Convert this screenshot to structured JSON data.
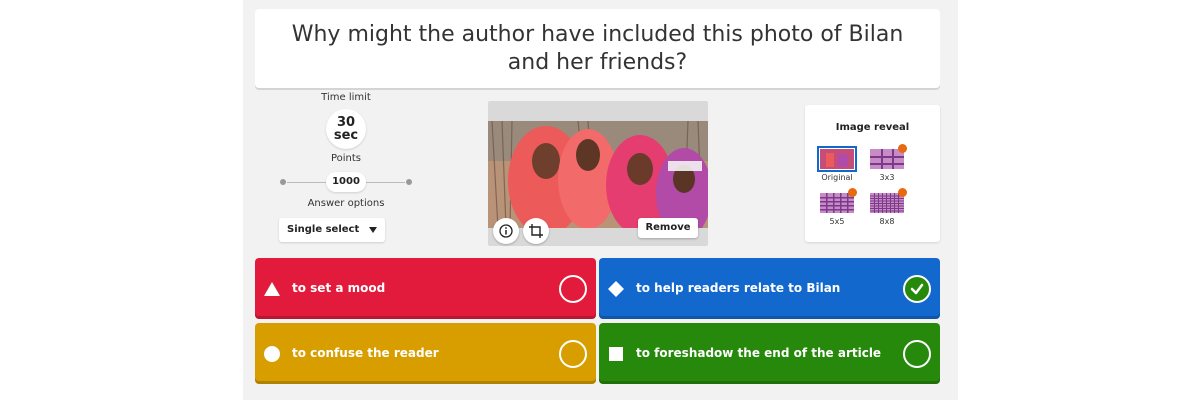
{
  "question": {
    "text": "Why might the author have included this photo of Bilan and her friends?"
  },
  "settings": {
    "time_limit_label": "Time limit",
    "time_value": "30",
    "time_unit": "sec",
    "points_label": "Points",
    "points_value": "1000",
    "answer_options_label": "Answer options",
    "answer_options_selected": "Single select"
  },
  "media": {
    "remove_label": "Remove",
    "info_icon": "info-icon",
    "crop_icon": "crop-icon"
  },
  "image_reveal": {
    "title": "Image reveal",
    "options": [
      {
        "label": "Original",
        "selected": true,
        "premium": false
      },
      {
        "label": "3x3",
        "selected": false,
        "premium": true
      },
      {
        "label": "5x5",
        "selected": false,
        "premium": true
      },
      {
        "label": "8x8",
        "selected": false,
        "premium": true
      }
    ]
  },
  "answers": [
    {
      "text": "to set a mood",
      "shape": "triangle",
      "color": "#e21b3c",
      "correct": false
    },
    {
      "text": "to help readers relate to Bilan",
      "shape": "diamond",
      "color": "#1368ce",
      "correct": true
    },
    {
      "text": "to confuse the reader",
      "shape": "circle",
      "color": "#d89e00",
      "correct": false
    },
    {
      "text": "to foreshadow the end of the article",
      "shape": "square",
      "color": "#26890c",
      "correct": false
    }
  ]
}
